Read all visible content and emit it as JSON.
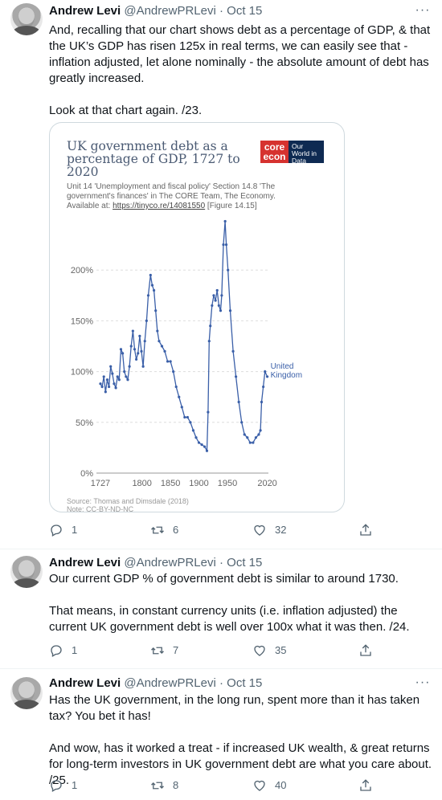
{
  "tweets": [
    {
      "author": "Andrew Levi",
      "handle": "@AndrewPRLevi",
      "date": "Oct 15",
      "text": "And, recalling that our chart shows debt as a percentage of GDP, & that the UK’s GDP has risen 125x in real terms, we can easily see that - inflation adjusted, let alone nominally - the absolute amount of debt has greatly increased.\n\nLook at that chart again. /23.",
      "replies": "1",
      "retweets": "6",
      "likes": "32"
    },
    {
      "author": "Andrew Levi",
      "handle": "@AndrewPRLevi",
      "date": "Oct 15",
      "text": "Our current GDP % of government debt is similar to around 1730.\n\nThat means, in constant currency units (i.e. inflation adjusted) the current UK government debt is well over 100x what it was then. /24.",
      "replies": "1",
      "retweets": "7",
      "likes": "35"
    },
    {
      "author": "Andrew Levi",
      "handle": "@AndrewPRLevi",
      "date": "Oct 15",
      "text": "Has the UK government, in the long run, spent more than it has taken tax? You bet it has!\n\nAnd wow, has it worked a treat - if increased UK wealth, & great returns for long-term investors in UK government debt are what you care about. /25.",
      "replies": "1",
      "retweets": "8",
      "likes": "40"
    }
  ],
  "separator": "·",
  "chart_card": {
    "title": "UK government debt as a percentage of GDP, 1727 to 2020",
    "subtitle_prefix": "Unit 14 'Unemployment and fiscal policy' Section 14.8 'The government's finances' in The CORE Team, The Economy. Available at: ",
    "subtitle_link": "https://tinyco.re/14081550",
    "subtitle_suffix": " [Figure 14.15]",
    "logo_core_line1": "core",
    "logo_core_line2": "econ",
    "logo_owid": "Our World in Data",
    "source": "Source: Thomas and Dimsdale (2018)",
    "note": "Note: CC-BY-ND-NC",
    "series_label_line1": "United",
    "series_label_line2": "Kingdom",
    "accent": "#3a5fa8"
  },
  "chart_data": {
    "type": "line",
    "title": "UK government debt as a percentage of GDP, 1727 to 2020",
    "xlabel": "",
    "ylabel": "",
    "xlim": [
      1720,
      2022
    ],
    "ylim": [
      0,
      250
    ],
    "x_ticks": [
      "1727",
      "1800",
      "1850",
      "1900",
      "1950",
      "2020"
    ],
    "x_tick_values": [
      1727,
      1800,
      1850,
      1900,
      1950,
      2020
    ],
    "y_ticks": [
      "0%",
      "50%",
      "100%",
      "150%",
      "200%"
    ],
    "y_tick_values": [
      0,
      50,
      100,
      150,
      200
    ],
    "series": [
      {
        "name": "United Kingdom",
        "x": [
          1727,
          1730,
          1733,
          1736,
          1739,
          1742,
          1745,
          1748,
          1751,
          1754,
          1757,
          1760,
          1763,
          1766,
          1769,
          1772,
          1775,
          1778,
          1781,
          1784,
          1787,
          1790,
          1793,
          1796,
          1799,
          1802,
          1805,
          1808,
          1811,
          1815,
          1818,
          1821,
          1824,
          1827,
          1830,
          1835,
          1840,
          1845,
          1850,
          1855,
          1860,
          1865,
          1870,
          1875,
          1880,
          1885,
          1890,
          1895,
          1900,
          1905,
          1910,
          1914,
          1916,
          1918,
          1920,
          1923,
          1926,
          1929,
          1932,
          1935,
          1938,
          1940,
          1943,
          1946,
          1948,
          1951,
          1955,
          1960,
          1965,
          1970,
          1975,
          1980,
          1985,
          1990,
          1995,
          2000,
          2005,
          2008,
          2010,
          2013,
          2016,
          2020
        ],
        "y": [
          88,
          85,
          95,
          80,
          92,
          85,
          105,
          98,
          88,
          84,
          95,
          92,
          122,
          118,
          100,
          95,
          92,
          105,
          125,
          140,
          122,
          112,
          118,
          135,
          120,
          105,
          130,
          150,
          175,
          195,
          185,
          180,
          160,
          140,
          130,
          125,
          120,
          110,
          110,
          100,
          85,
          75,
          65,
          55,
          55,
          50,
          42,
          35,
          30,
          28,
          26,
          22,
          60,
          130,
          145,
          165,
          175,
          170,
          180,
          165,
          160,
          175,
          225,
          248,
          225,
          200,
          160,
          120,
          95,
          70,
          50,
          38,
          35,
          30,
          30,
          35,
          38,
          42,
          70,
          85,
          100,
          95
        ]
      }
    ]
  }
}
